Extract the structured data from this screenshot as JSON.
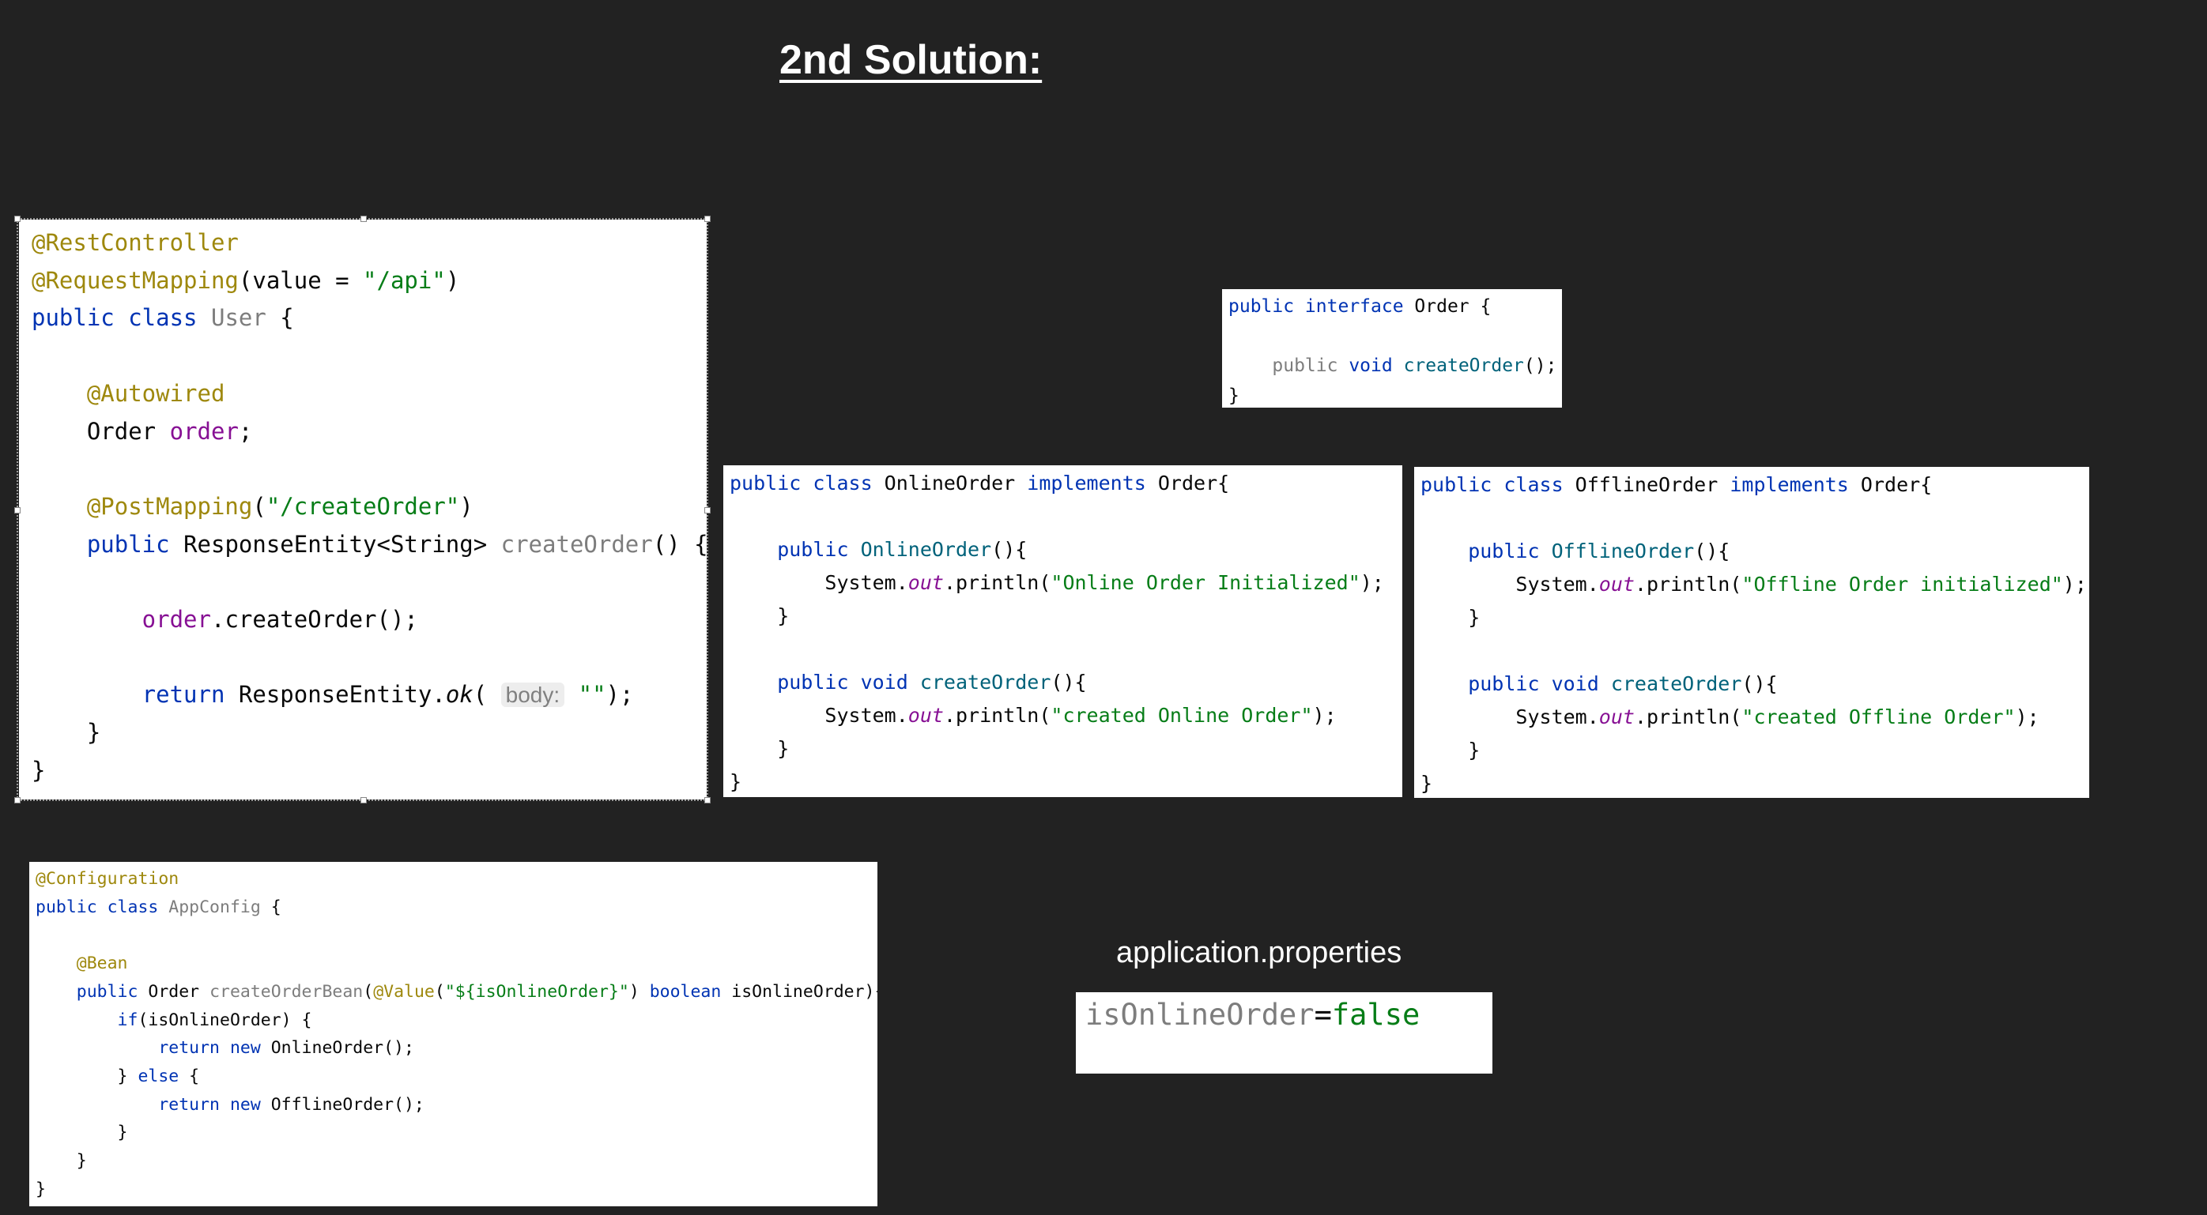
{
  "slide": {
    "title": "2nd Solution:"
  },
  "user_class": {
    "l1": "@RestController",
    "l2_ann": "@RequestMapping",
    "l2_a": "(value = ",
    "l2_str": "\"/api\"",
    "l2_b": ")",
    "l3_kw": "public class ",
    "l3_name": "User",
    "l3_b": " {",
    "l5": "    @Autowired",
    "l6_a": "    Order ",
    "l6_fld": "order",
    "l6_b": ";",
    "l8_ann": "    @PostMapping",
    "l8_a": "(",
    "l8_str": "\"/createOrder\"",
    "l8_b": ")",
    "l9_kw": "    public ",
    "l9_type": "ResponseEntity<String> ",
    "l9_fn": "createOrder",
    "l9_b": "() {",
    "l11_fld": "        order",
    "l11_b": ".createOrder();",
    "l13_kw": "        return ",
    "l13_a": "ResponseEntity.",
    "l13_it": "ok",
    "l13_b": "( ",
    "l13_hint": "body:",
    "l13_str": " \"\"",
    "l13_c": ");",
    "l14": "    }",
    "l15": "}"
  },
  "interface_class": {
    "l1_kw": "public interface ",
    "l1_b": "Order {",
    "l3_gray": "    public ",
    "l3_kw": "void ",
    "l3_fn": "createOrder",
    "l3_b": "();",
    "l4": "}"
  },
  "online_class": {
    "l1_kw": "public class ",
    "l1_a": "OnlineOrder ",
    "l1_kw2": "implements ",
    "l1_b": "Order{",
    "l3_kw": "    public ",
    "l3_fn": "OnlineOrder",
    "l3_b": "(){",
    "l4_a": "        System.",
    "l4_it": "out",
    "l4_b": ".println(",
    "l4_str": "\"Online Order Initialized\"",
    "l4_c": ");",
    "l5": "    }",
    "l7_kw": "    public void ",
    "l7_fn": "createOrder",
    "l7_b": "(){",
    "l8_a": "        System.",
    "l8_it": "out",
    "l8_b": ".println(",
    "l8_str": "\"created Online Order\"",
    "l8_c": ");",
    "l9": "    }",
    "l10": "}"
  },
  "offline_class": {
    "l1_kw": "public class ",
    "l1_a": "OfflineOrder ",
    "l1_kw2": "implements ",
    "l1_b": "Order{",
    "l3_kw": "    public ",
    "l3_fn": "OfflineOrder",
    "l3_b": "(){",
    "l4_a": "        System.",
    "l4_it": "out",
    "l4_b": ".println(",
    "l4_str": "\"Offline Order initialized\"",
    "l4_c": ");",
    "l5": "    }",
    "l7_kw": "    public void ",
    "l7_fn": "createOrder",
    "l7_b": "(){",
    "l8_a": "        System.",
    "l8_it": "out",
    "l8_b": ".println(",
    "l8_str": "\"created Offline Order\"",
    "l8_c": ");",
    "l9": "    }",
    "l10": "}"
  },
  "config_class": {
    "l1": "@Configuration",
    "l2_kw": "public class ",
    "l2_name": "AppConfig",
    "l2_b": " {",
    "l4": "    @Bean",
    "l5_kw": "    public ",
    "l5_a": "Order ",
    "l5_fn": "createOrderBean",
    "l5_b": "(",
    "l5_ann": "@Value",
    "l5_c": "(",
    "l5_str": "\"${isOnlineOrder}\"",
    "l5_d": ") ",
    "l5_kw2": "boolean ",
    "l5_e": "isOnlineOrder){",
    "l6_kw": "        if",
    "l6_b": "(isOnlineOrder) {",
    "l7_kw": "            return new ",
    "l7_b": "OnlineOrder();",
    "l8_a": "        } ",
    "l8_kw": "else",
    "l8_b": " {",
    "l9_kw": "            return new ",
    "l9_b": "OfflineOrder();",
    "l10": "        }",
    "l11": "    }",
    "l12": "}"
  },
  "properties": {
    "label": "application.properties",
    "key": "isOnlineOrder",
    "eq": "=",
    "value": "false"
  },
  "colors": {
    "background": "#222222",
    "keyword": "#0033b3",
    "annotation": "#9e880d",
    "string": "#067d17",
    "field": "#871094"
  }
}
